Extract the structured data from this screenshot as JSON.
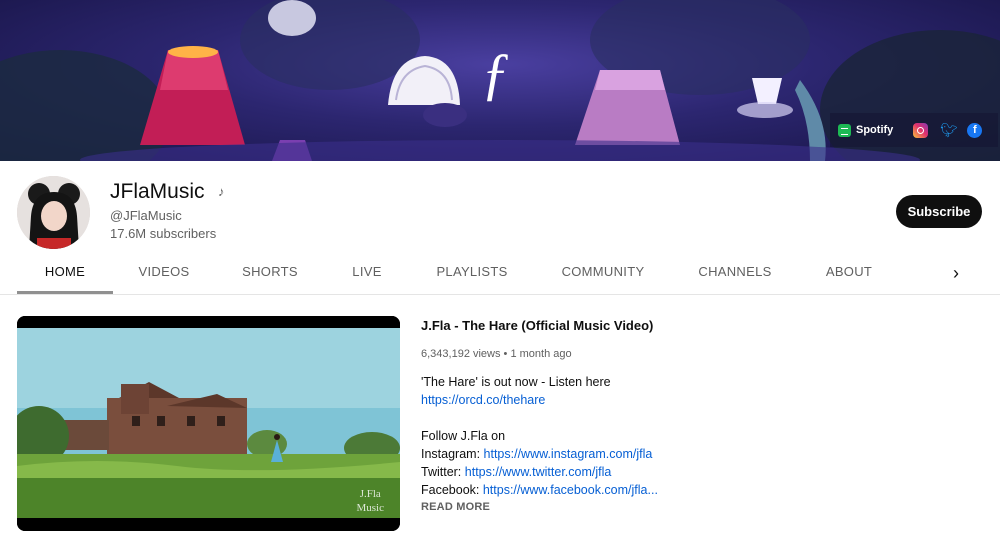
{
  "banner": {
    "logo": "ƒ",
    "links": {
      "spotify_label": "Spotify",
      "spotify_icon": "spotify-icon",
      "instagram_icon": "instagram-icon",
      "twitter_icon": "twitter-icon",
      "facebook_icon": "facebook-icon"
    }
  },
  "channel": {
    "name": "JFlaMusic",
    "music_note": "♪",
    "handle": "@JFlaMusic",
    "subscribers": "17.6M subscribers",
    "subscribe_label": "Subscribe"
  },
  "tabs": [
    {
      "label": "HOME",
      "active": true
    },
    {
      "label": "VIDEOS"
    },
    {
      "label": "SHORTS"
    },
    {
      "label": "LIVE"
    },
    {
      "label": "PLAYLISTS"
    },
    {
      "label": "COMMUNITY"
    },
    {
      "label": "CHANNELS"
    },
    {
      "label": "ABOUT"
    }
  ],
  "tabs_next": "›",
  "featured": {
    "watermark_line1": "J.Fla",
    "watermark_line2": "Music",
    "title": "J.Fla - The Hare (Official Music Video)",
    "meta": "6,343,192 views • 1 month ago",
    "desc_line1": "'The Hare' is out now - Listen here",
    "desc_link1": "https://orcd.co/thehare",
    "follow": "Follow J.Fla on",
    "instagram_label": "Instagram: ",
    "instagram_link": "https://www.instagram.com/jfla",
    "twitter_label": "Twitter: ",
    "twitter_link": "https://www.twitter.com/jfla",
    "facebook_label": "Facebook: ",
    "facebook_link": "https://www.facebook.com/jfla...",
    "read_more": "READ MORE"
  },
  "colors": {
    "subscribe_bg": "#0f0f0f",
    "link": "#065fd4",
    "banner_bg": "#2c2670"
  }
}
